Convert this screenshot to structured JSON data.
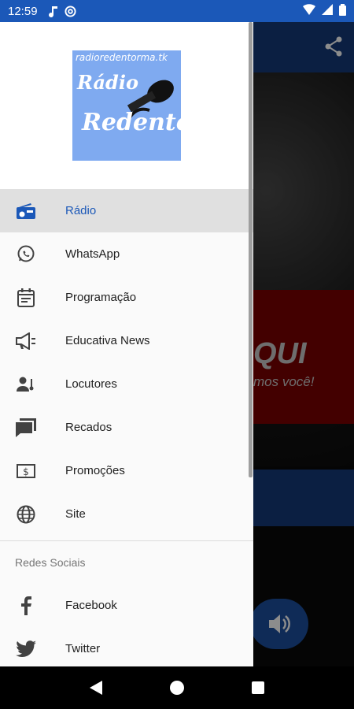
{
  "status_bar": {
    "time": "12:59"
  },
  "logo": {
    "url_text": "radioredentorma.tk",
    "word1": "Rádio",
    "word2": "Redentor"
  },
  "menu": {
    "items": [
      {
        "label": "Rádio",
        "icon": "radio-icon",
        "active": true
      },
      {
        "label": "WhatsApp",
        "icon": "whatsapp-icon"
      },
      {
        "label": "Programação",
        "icon": "calendar-icon"
      },
      {
        "label": "Educativa News",
        "icon": "megaphone-icon"
      },
      {
        "label": "Locutores",
        "icon": "person-icon"
      },
      {
        "label": "Recados",
        "icon": "chat-icon"
      },
      {
        "label": "Promoções",
        "icon": "money-icon"
      },
      {
        "label": "Site",
        "icon": "globe-icon"
      }
    ],
    "section_title": "Redes Sociais",
    "social": [
      {
        "label": "Facebook",
        "icon": "facebook-icon"
      },
      {
        "label": "Twitter",
        "icon": "twitter-icon"
      }
    ]
  },
  "background": {
    "banner_text": "QUI",
    "banner_subtext": "mos você!"
  },
  "colors": {
    "accent": "#1b58b8",
    "status_bar": "#1b58b8",
    "toolbar": "#153a78",
    "drawer_bg": "#fafafa",
    "active_bg": "#e0e0e0"
  }
}
